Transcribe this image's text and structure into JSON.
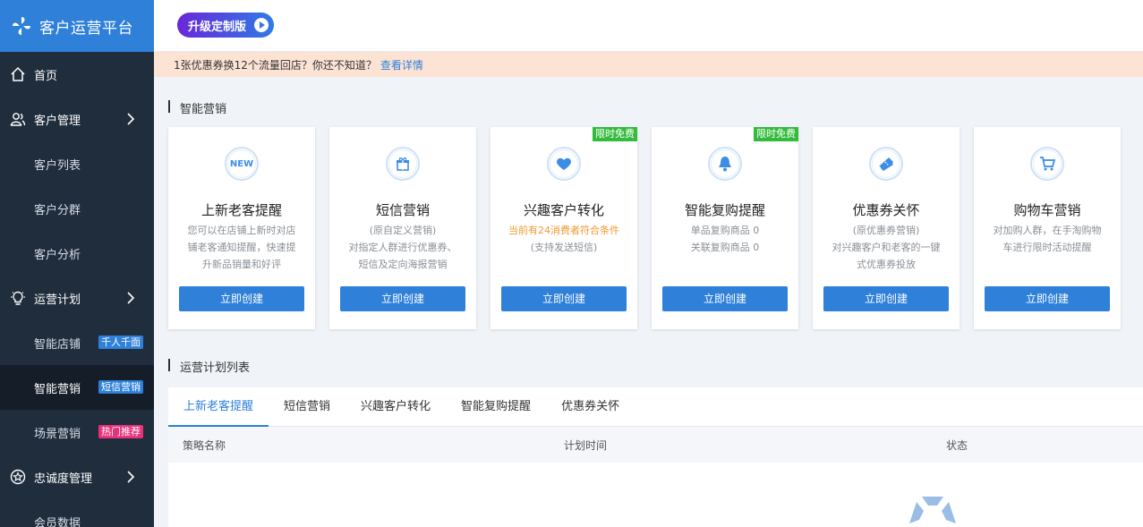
{
  "app": {
    "title": "客户运营平台"
  },
  "sidebar": {
    "home": "首页",
    "customer_mgmt": "客户管理",
    "customer_list": "客户列表",
    "customer_group": "客户分群",
    "customer_analysis": "客户分析",
    "ops_plan": "运营计划",
    "smart_store": "智能店铺",
    "smart_store_badge": "千人千面",
    "smart_marketing": "智能营销",
    "smart_marketing_badge": "短信营销",
    "scene_marketing": "场景营销",
    "scene_marketing_badge": "热门推荐",
    "loyalty_mgmt": "忠诚度管理",
    "member_data": "会员数据"
  },
  "header": {
    "upgrade_label": "升级定制版"
  },
  "notice": {
    "text": "1张优惠券换12个流量回店？你还不知道？",
    "link": "查看详情"
  },
  "smart_section": {
    "title": "智能营销"
  },
  "cards": [
    {
      "icon": "new-icon",
      "icon_text": "NEW",
      "title": "上新老客提醒",
      "lines": [
        "您可以在店铺上新时对店",
        "铺老客通知提醒，快速提",
        "升新品销量和好评"
      ],
      "button": "立即创建"
    },
    {
      "icon": "gift-icon",
      "title": "短信营销",
      "lines": [
        "(原自定义营销)",
        "对指定人群进行优惠券、",
        "短信及定向海报营销"
      ],
      "button": "立即创建"
    },
    {
      "icon": "heart-icon",
      "ribbon": "限时免费",
      "title": "兴趣客户转化",
      "warn": "当前有24消费者符合条件",
      "lines": [
        "(支持发送短信)"
      ],
      "button": "立即创建"
    },
    {
      "icon": "bell-icon",
      "ribbon": "限时免费",
      "title": "智能复购提醒",
      "lines": [
        "单品复购商品 0",
        "关联复购商品 0"
      ],
      "button": "立即创建"
    },
    {
      "icon": "ticket-icon",
      "title": "优惠券关怀",
      "lines": [
        "(原优惠券营销)",
        "对兴趣客户和老客的一键",
        "式优惠券投放"
      ],
      "button": "立即创建"
    },
    {
      "icon": "cart-icon",
      "title": "购物车营销",
      "lines": [
        "对加购人群，在手淘购物",
        "车进行限时活动提醒"
      ],
      "button": "立即创建"
    }
  ],
  "plan_section": {
    "title": "运营计划列表"
  },
  "tabs": [
    "上新老客提醒",
    "短信营销",
    "兴趣客户转化",
    "智能复购提醒",
    "优惠券关怀"
  ],
  "table": {
    "columns": [
      "策略名称",
      "计划时间",
      "状态"
    ]
  },
  "colors": {
    "accent": "#2f80d9",
    "sidebar": "#1f2d3d",
    "ribbon": "#33bb3c",
    "warn": "#f09a30"
  }
}
